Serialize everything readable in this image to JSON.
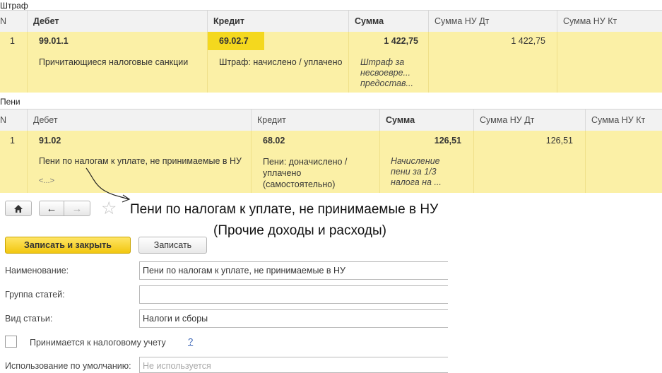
{
  "shtraf": {
    "title": "Штраф",
    "headers": {
      "n": "N",
      "debit": "Дебет",
      "credit": "Кредит",
      "sum": "Сумма",
      "nu_dt": "Сумма НУ Дт",
      "nu_kt": "Сумма НУ Кт"
    },
    "row": {
      "n": "1",
      "debit_account": "99.01.1",
      "debit_desc": "Причитающиеся налоговые санкции",
      "credit_account": "69.02.7",
      "credit_desc": "Штраф: начислено / уплачено",
      "sum": "1 422,75",
      "sum_desc": "Штраф за несвоевре... предостав...",
      "nu_dt": "1 422,75"
    }
  },
  "peni": {
    "title": "Пени",
    "headers": {
      "n": "N",
      "debit": "Дебет",
      "credit": "Кредит",
      "sum": "Сумма",
      "nu_dt": "Сумма НУ Дт",
      "nu_kt": "Сумма НУ Кт"
    },
    "row": {
      "n": "1",
      "debit_account": "91.02",
      "debit_desc": "Пени по налогам к уплате, не принимаемые в НУ",
      "debit_sub": "<...>",
      "credit_account": "68.02",
      "credit_desc": "Пени: доначислено / уплачено (самостоятельно)",
      "sum": "126,51",
      "sum_desc": "Начисление пени за 1/3 налога на ...",
      "nu_dt": "126,51"
    }
  },
  "form": {
    "title_line1": "Пени по налогам к уплате, не принимаемые в НУ",
    "title_line2": "(Прочие доходы и расходы)",
    "save_close_label": "Записать и закрыть",
    "save_label": "Записать",
    "name_label": "Наименование:",
    "name_value": "Пени по налогам к уплате, не принимаемые в НУ",
    "group_label": "Группа статей:",
    "group_value": "",
    "kind_label": "Вид статьи:",
    "kind_value": "Налоги и сборы",
    "tax_checkbox_label": "Принимается к налоговому учету",
    "tax_checkbox_checked": false,
    "help_label": "?",
    "default_use_label": "Использование по умолчанию:",
    "default_use_placeholder": "Не используется"
  },
  "icons": [
    "home-icon",
    "back-arrow-icon",
    "forward-arrow-icon",
    "star-icon"
  ],
  "colors": {
    "row_highlight": "#fbf0a6",
    "cell_highlight": "#f4d81e",
    "primary_button": "#f2c70f"
  }
}
